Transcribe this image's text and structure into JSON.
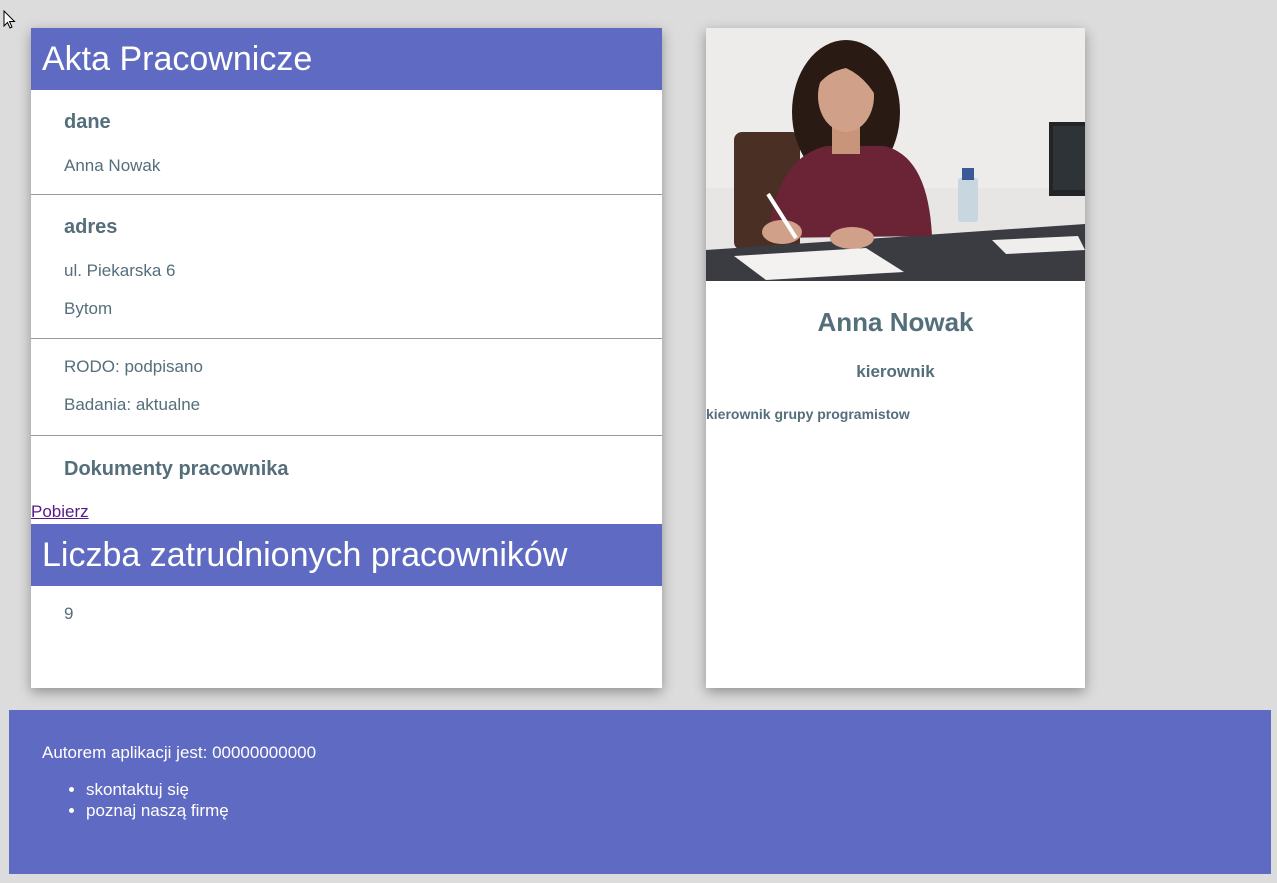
{
  "employee_file": {
    "title": "Akta Pracownicze",
    "data_section": {
      "heading": "dane",
      "full_name": "Anna Nowak"
    },
    "address_section": {
      "heading": "adres",
      "street": "ul. Piekarska 6",
      "city": "Bytom"
    },
    "status_section": {
      "rodo": "RODO: podpisano",
      "medical": "Badania: aktualne"
    },
    "documents_section": {
      "heading": "Dokumenty pracownika",
      "download_label": "Pobierz"
    }
  },
  "employee_count": {
    "title": "Liczba zatrudnionych pracowników",
    "value": "9"
  },
  "profile": {
    "name": "Anna Nowak",
    "role": "kierownik",
    "description": "kierownik grupy programistow"
  },
  "footer": {
    "author": "Autorem aplikacji jest: 00000000000",
    "links": [
      "skontaktuj się",
      "poznaj naszą firmę"
    ]
  },
  "colors": {
    "accent": "#5f6bc2",
    "text": "#546e7a",
    "background": "#dcdcdc"
  }
}
